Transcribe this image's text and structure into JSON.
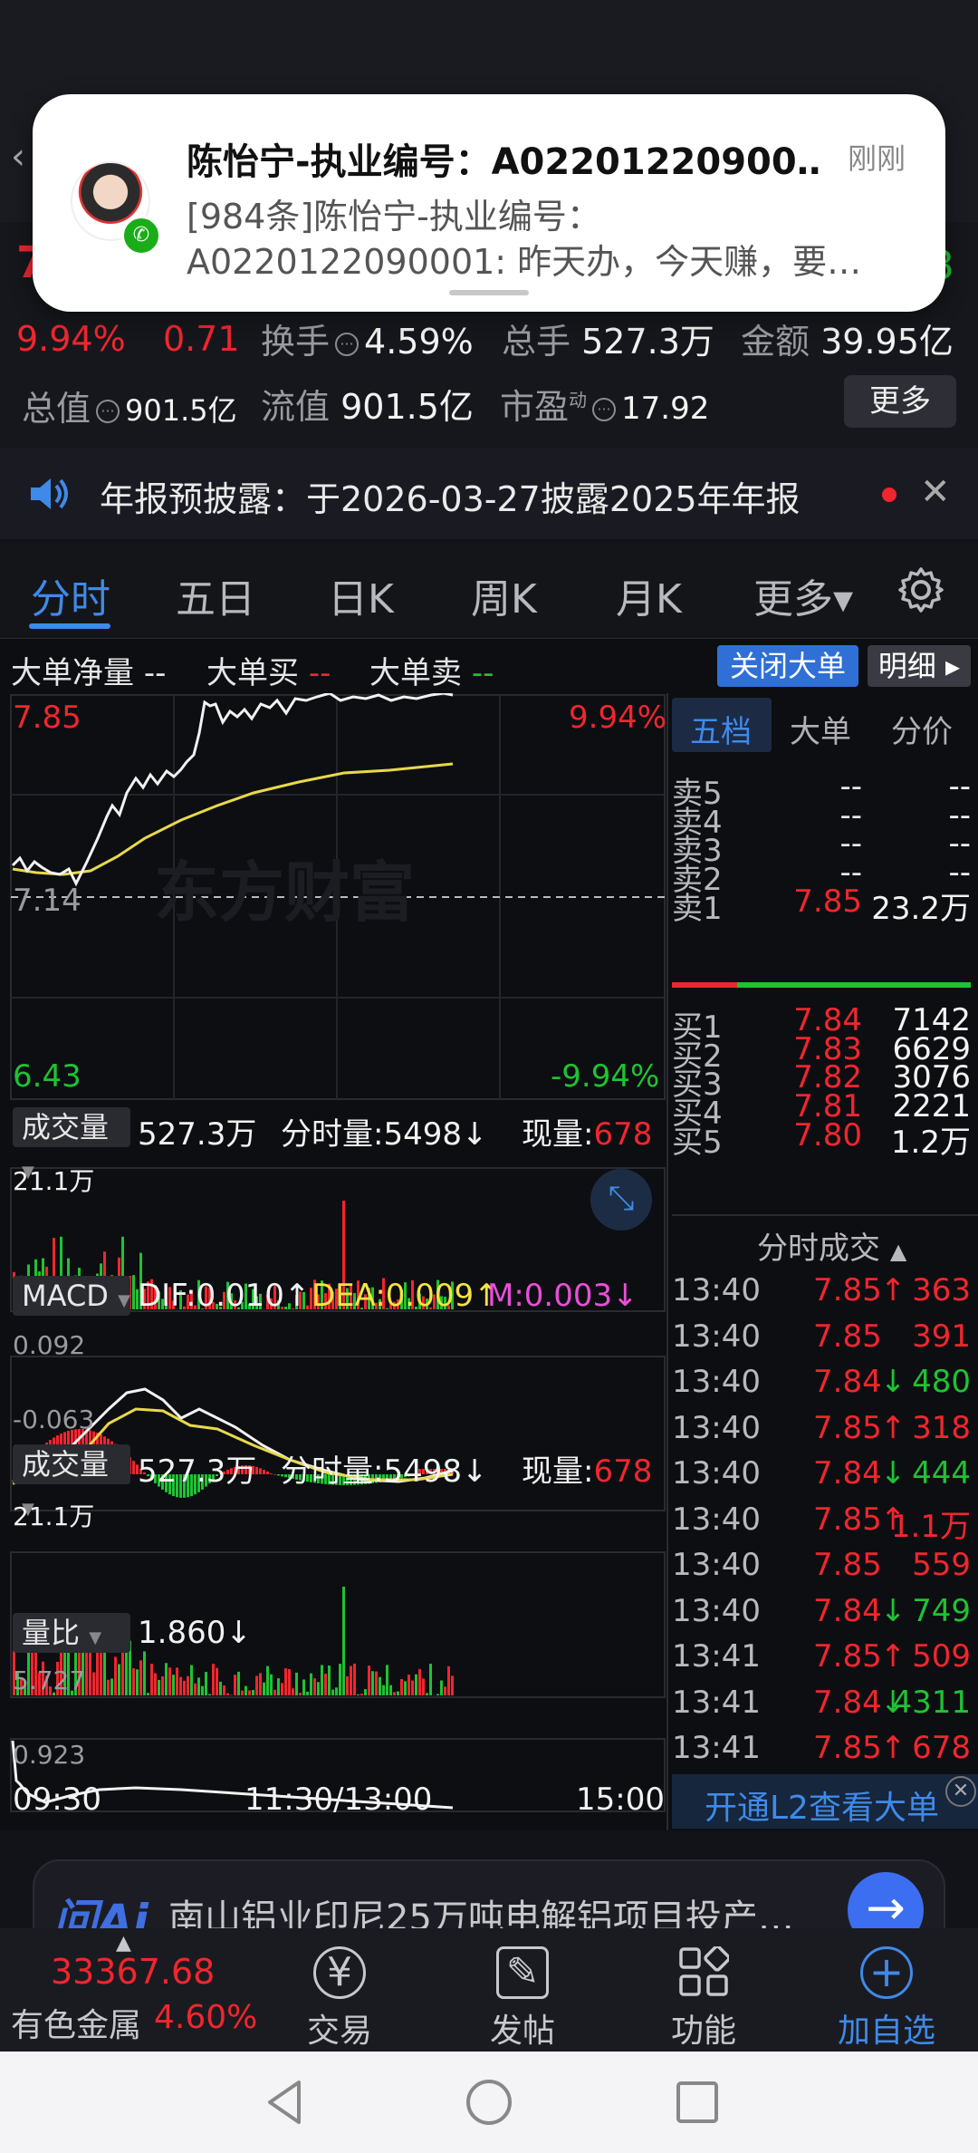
{
  "notification": {
    "title": "陈怡宁-执业编号：A02201220900…",
    "time": "刚刚",
    "body_line1": "[984条]陈怡宁-执业编号：",
    "body_line2": "A0220122090001: 昨天办，今天赚，要…"
  },
  "stats": {
    "pct_change": "9.94%",
    "price_change": "0.71",
    "turnover_label": "换手",
    "turnover_value": "4.59%",
    "total_volume_label": "总手",
    "total_volume_value": "527.3万",
    "amount_label": "金额",
    "amount_value": "39.95亿",
    "total_cap_label": "总值",
    "total_cap_value": "901.5亿",
    "float_cap_label": "流值",
    "float_cap_value": "901.5亿",
    "pe_label": "市盈",
    "pe_sup": "动",
    "pe_value": "17.92",
    "more_label": "更多"
  },
  "banner": {
    "text": "年报预披露：于2026-03-27披露2025年年报"
  },
  "tabs": [
    "分时",
    "五日",
    "日K",
    "周K",
    "月K",
    "更多▾"
  ],
  "bigorder": {
    "net_label": "大单净量",
    "net_value": "--",
    "buy_label": "大单买",
    "buy_value": "--",
    "sell_label": "大单卖",
    "sell_value": "--",
    "close_btn": "关闭大单",
    "detail_btn": "明细 ▸"
  },
  "chart": {
    "y_high": "7.85",
    "y_mid": "7.14",
    "y_low": "6.43",
    "pct_high": "9.94%",
    "pct_low": "-9.94%",
    "watermark": "东方财富",
    "x_start": "09:30",
    "x_mid": "11:30/13:00",
    "x_end": "15:00"
  },
  "volume1": {
    "dropdown": "成交量",
    "total": "527.3万",
    "minute_label": "分时量:5498↓",
    "now_label": "现量:",
    "now_value": "678",
    "max": "21.1万"
  },
  "macd": {
    "dropdown": "MACD",
    "dif": "DIF:0.010↑",
    "dea": "DEA:0.009↑",
    "m": "M:0.003↓",
    "top": "0.092",
    "bottom": "-0.063"
  },
  "volume2": {
    "dropdown": "成交量",
    "total": "527.3万",
    "minute_label": "分时量:5498↓",
    "now_label": "现量:",
    "now_value": "678",
    "max": "21.1万"
  },
  "vol_ratio": {
    "dropdown": "量比",
    "value": "1.860↓",
    "top": "5.727",
    "bottom": "0.923"
  },
  "right_panel": {
    "tabs": [
      "五档",
      "大单",
      "分价"
    ],
    "sells": [
      {
        "label": "卖5",
        "price": "--",
        "vol": "--"
      },
      {
        "label": "卖4",
        "price": "--",
        "vol": "--"
      },
      {
        "label": "卖3",
        "price": "--",
        "vol": "--"
      },
      {
        "label": "卖2",
        "price": "--",
        "vol": "--"
      },
      {
        "label": "卖1",
        "price": "7.85",
        "vol": "23.2万"
      }
    ],
    "buys": [
      {
        "label": "买1",
        "price": "7.84",
        "vol": "7142"
      },
      {
        "label": "买2",
        "price": "7.83",
        "vol": "6629"
      },
      {
        "label": "买3",
        "price": "7.82",
        "vol": "3076"
      },
      {
        "label": "买4",
        "price": "7.81",
        "vol": "2221"
      },
      {
        "label": "买5",
        "price": "7.80",
        "vol": "1.2万"
      }
    ],
    "ticks_header": "分时成交",
    "ticks": [
      {
        "time": "13:40",
        "price": "7.85",
        "arrow": "↑",
        "vol": "363",
        "dir": "up"
      },
      {
        "time": "13:40",
        "price": "7.85",
        "arrow": "",
        "vol": "391",
        "dir": "up"
      },
      {
        "time": "13:40",
        "price": "7.84",
        "arrow": "↓",
        "vol": "480",
        "dir": "down"
      },
      {
        "time": "13:40",
        "price": "7.85",
        "arrow": "↑",
        "vol": "318",
        "dir": "up"
      },
      {
        "time": "13:40",
        "price": "7.84",
        "arrow": "↓",
        "vol": "444",
        "dir": "down"
      },
      {
        "time": "13:40",
        "price": "7.85",
        "arrow": "↑",
        "vol": "1.1万",
        "dir": "up"
      },
      {
        "time": "13:40",
        "price": "7.85",
        "arrow": "",
        "vol": "559",
        "dir": "up"
      },
      {
        "time": "13:40",
        "price": "7.84",
        "arrow": "↓",
        "vol": "749",
        "dir": "down"
      },
      {
        "time": "13:41",
        "price": "7.85",
        "arrow": "↑",
        "vol": "509",
        "dir": "up"
      },
      {
        "time": "13:41",
        "price": "7.84",
        "arrow": "↓",
        "vol": "4311",
        "dir": "down"
      },
      {
        "time": "13:41",
        "price": "7.85",
        "arrow": "↑",
        "vol": "678",
        "dir": "up"
      }
    ],
    "l2_text": "开通L2查看大单"
  },
  "ai": {
    "logo": "问Ai",
    "text": "南山铝业印尼25万吨电解铝项目投产…"
  },
  "bottom_nav": {
    "index_value": "33367.68",
    "index_name": "有色金属",
    "index_pct": "4.60%",
    "items": [
      "交易",
      "发帖",
      "功能",
      "加自选"
    ]
  },
  "colors": {
    "up": "#f0262e",
    "down": "#1fc233",
    "accent": "#3f8ae8",
    "avg_line": "#e8d84a"
  }
}
